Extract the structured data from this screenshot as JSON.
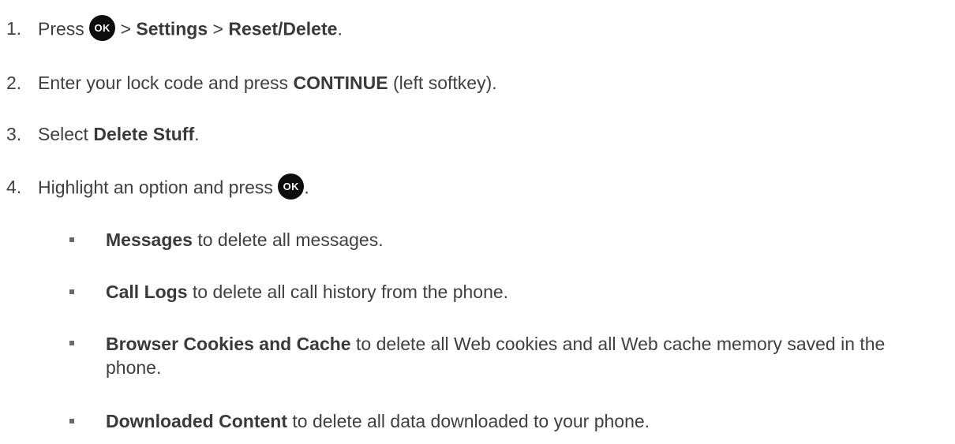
{
  "steps": [
    {
      "number": "1.",
      "text_a": "Press ",
      "button": "OK",
      "text_b": " > ",
      "bold_1": "Settings",
      "text_c": " > ",
      "bold_2": "Reset/Delete",
      "text_d": "."
    },
    {
      "number": "2.",
      "text_a": "Enter your lock code and press ",
      "bold_1": "CONTINUE",
      "text_b": " (left softkey)."
    },
    {
      "number": "3.",
      "text_a": "Select ",
      "bold_1": "Delete Stuff",
      "text_b": "."
    },
    {
      "number": "4.",
      "text_a": "Highlight an option and press ",
      "button": "OK",
      "text_b": "."
    }
  ],
  "options": [
    {
      "bold": "Messages",
      "text": " to delete all messages."
    },
    {
      "bold": "Call Logs",
      "text": " to delete all call history from the phone."
    },
    {
      "bold": "Browser Cookies and Cache",
      "text": " to delete all Web cookies and all Web cache memory saved in the phone."
    },
    {
      "bold": "Downloaded Content",
      "text": " to delete all data downloaded to your phone."
    }
  ]
}
